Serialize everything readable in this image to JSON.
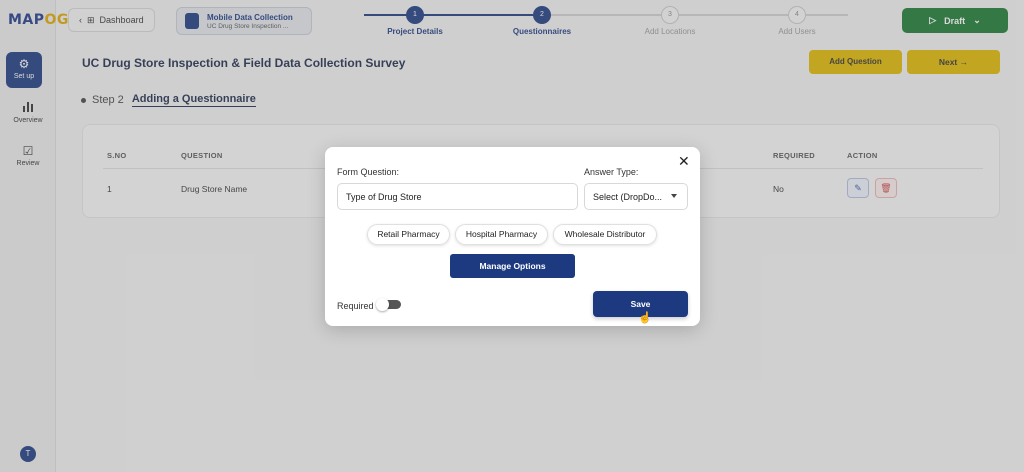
{
  "app": {
    "logo": "MAP",
    "logo_accent": "OG"
  },
  "sidebar": {
    "items": [
      {
        "label": "Set up",
        "icon": "gear-icon"
      },
      {
        "label": "Overview",
        "icon": "bar-chart-icon"
      },
      {
        "label": "Review",
        "icon": "checkbox-icon"
      }
    ],
    "avatar": "T"
  },
  "topbar": {
    "back_label": "Dashboard",
    "project": {
      "title": "Mobile Data Collection",
      "subtitle": "UC Drug Store Inspection ..."
    },
    "steps": [
      {
        "num": "1",
        "label": "Project Details",
        "state": "done"
      },
      {
        "num": "2",
        "label": "Questionnaires",
        "state": "active"
      },
      {
        "num": "3",
        "label": "Add Locations",
        "state": "todo"
      },
      {
        "num": "4",
        "label": "Add Users",
        "state": "todo"
      }
    ],
    "draft_label": "Draft"
  },
  "page": {
    "title": "UC Drug Store Inspection & Field Data Collection Survey",
    "add_question_label": "Add Question",
    "next_label": "Next",
    "step_prefix": "Step 2",
    "step_title": "Adding a Questionnaire"
  },
  "table": {
    "headers": {
      "sno": "S.NO",
      "question": "QUESTION",
      "required": "REQUIRED",
      "action": "ACTION"
    },
    "rows": [
      {
        "sno": "1",
        "question": "Drug Store Name",
        "required": "No"
      }
    ]
  },
  "modal": {
    "question_label": "Form Question:",
    "question_value": "Type of Drug Store",
    "answer_type_label": "Answer Type:",
    "answer_type_value": "Select (DropDo...",
    "options": [
      "Retail Pharmacy",
      "Hospital Pharmacy",
      "Wholesale Distributor"
    ],
    "manage_label": "Manage Options",
    "required_label": "Required",
    "required_on": false,
    "save_label": "Save"
  },
  "colors": {
    "primary": "#1d3a80",
    "accent": "#e0b800",
    "draft": "#1b7a32",
    "danger": "#cc4444"
  }
}
